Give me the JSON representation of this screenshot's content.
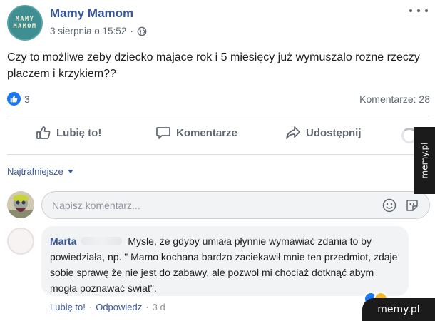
{
  "post": {
    "page_avatar_lines": [
      "MAMY",
      "MAMOM"
    ],
    "page_name": "Mamy Mamom",
    "date": "3 sierpnia o 15:52",
    "dot": "·",
    "text": "Czy to możliwe zeby dziecko majace rok i 5 miesięcy już wymuszalo rozne rzeczy placzem i krzykiem??",
    "privacy_icon": "globe-icon",
    "more_icon": "more-icon"
  },
  "stats": {
    "likes": "3",
    "comments": "Komentarze: 28"
  },
  "actions": {
    "like": "Lubię to!",
    "comment": "Komentarze",
    "share": "Udostępnij"
  },
  "sort": {
    "label": "Najtrafniejsze"
  },
  "composer": {
    "placeholder": "Napisz komentarz..."
  },
  "comment": {
    "author": "Marta",
    "text": "Mysle, że gdyby umiała płynnie wymawiać zdania to by powiedziała, np. \" Mamo kochana bardzo zaciekawił mnie ten przedmiot, zdaje sobie sprawę że nie jest do zabawy, ale pozwol mi chociaż dotknąć abym mogła poznawać świat\".",
    "like": "Lubię to!",
    "reply": "Odpowiedz",
    "sep": "·",
    "time": "3 d"
  },
  "watermark": {
    "side": "memy.pl",
    "bottom": "memy.pl"
  },
  "colors": {
    "link": "#385898",
    "like_blue": "#1877f2",
    "muted": "#606770",
    "bubble": "#f2f3f5"
  }
}
